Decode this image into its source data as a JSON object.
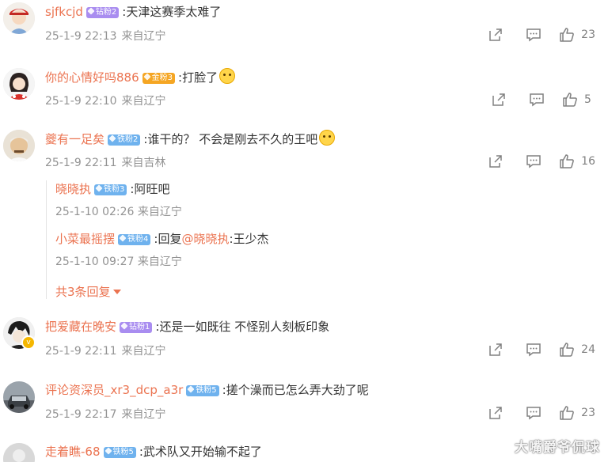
{
  "comments": [
    {
      "user": "sjfkcjd",
      "badge": "钻粉2",
      "text": ":天津这赛季太难了",
      "time": "25-1-9 22:13",
      "location": "来自辽宁",
      "likes": "23"
    },
    {
      "user": "你的心情好吗886",
      "badge": "金粉3",
      "text": ":打脸了",
      "time": "25-1-9 22:10",
      "location": "来自辽宁",
      "likes": "5"
    },
    {
      "user": "夔有一足矣",
      "badge": "铁粉2",
      "text": ":谁干的？ 不会是刚去不久的王吧",
      "time": "25-1-9 22:11",
      "location": "来自吉林",
      "likes": "16",
      "replies": [
        {
          "user": "晓晓执",
          "badge": "铁粉3",
          "text": ":阿旺吧",
          "time": "25-1-10 02:26",
          "location": "来自辽宁"
        },
        {
          "user": "小菜最摇摆",
          "badge": "铁粉4",
          "prefix": ":回复",
          "mention": "@晓晓执",
          "text": ":王少杰",
          "time": "25-1-10 09:27",
          "location": "来自辽宁"
        }
      ],
      "more_replies": "共3条回复"
    },
    {
      "user": "把爱藏在晚安",
      "badge": "钻粉1",
      "text": ":还是一如既往 不怪别人刻板印象",
      "time": "25-1-9 22:11",
      "location": "来自辽宁",
      "likes": "24"
    },
    {
      "user": "评论资深员_xr3_dcp_a3r",
      "badge": "铁粉5",
      "text": ":搓个澡而已怎么弄大劲了呢",
      "time": "25-1-9 22:17",
      "location": "来自辽宁",
      "likes": "23"
    },
    {
      "user": "走着瞧-68",
      "badge": "铁粉5",
      "text": ":武术队又开始输不起了"
    }
  ],
  "watermark": "大嘴爵爷侃球",
  "colors": {
    "name": "#eb7350",
    "meta": "#939393",
    "diamond_badge": "#a98df0",
    "gold_badge": "#f5a623",
    "iron_badge": "#6fb2ee"
  },
  "icons": {
    "share": "share-icon",
    "reply": "comment-icon",
    "like": "thumbs-up-icon"
  }
}
